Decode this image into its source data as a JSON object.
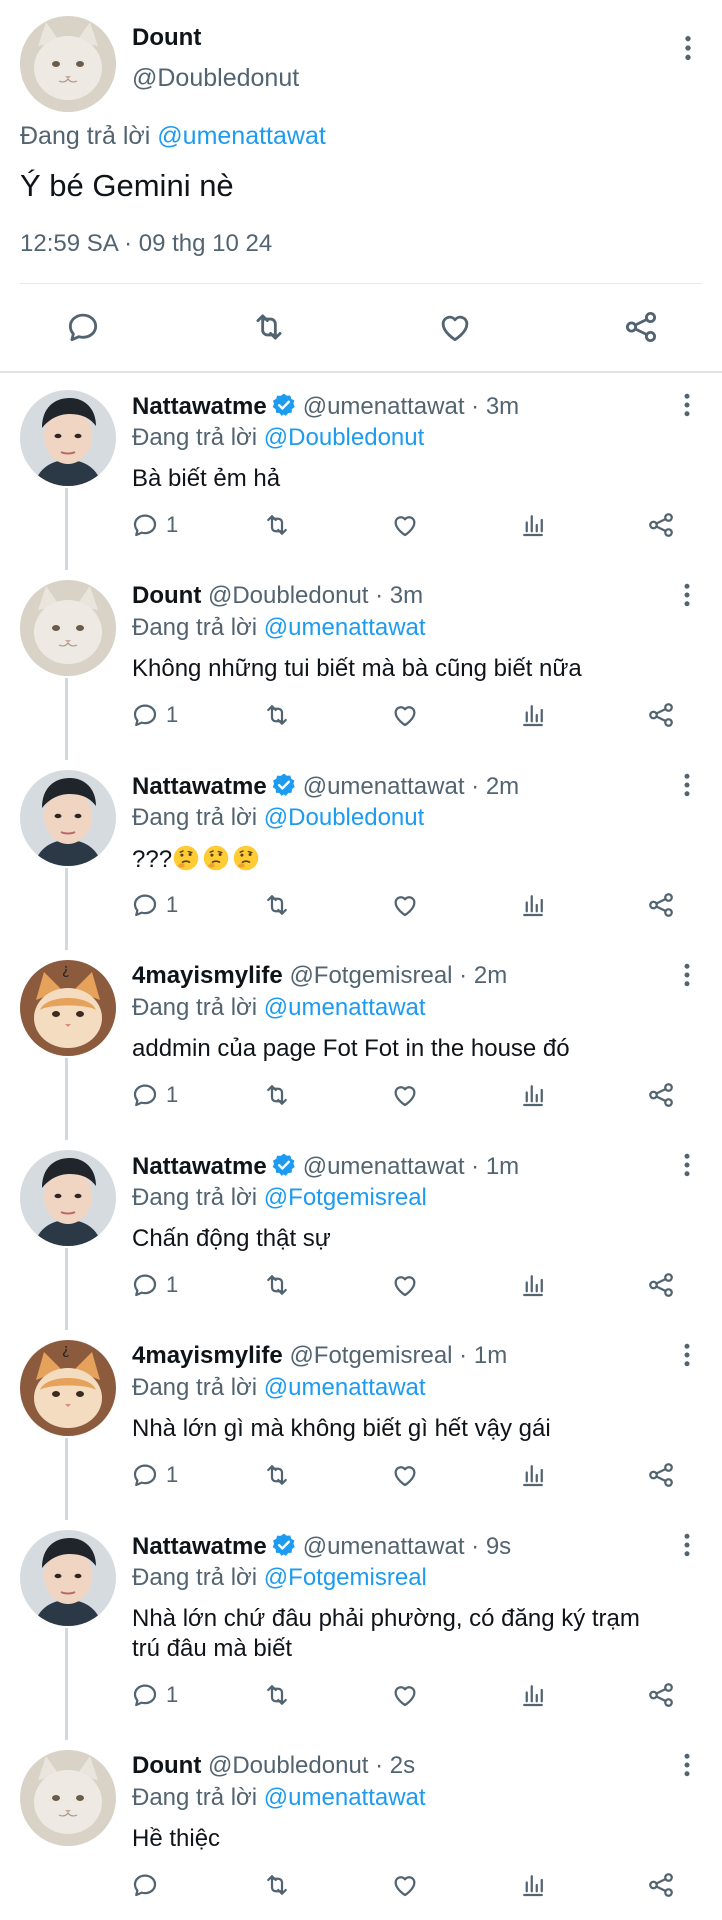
{
  "main_tweet": {
    "name": "Dount",
    "handle": "@Doubledonut",
    "reply_prefix": "Đang trả lời",
    "reply_to": "@umenattawat",
    "text": "Ý bé Gemini nè",
    "timestamp": "12:59 SA · 09 thg 10 24"
  },
  "replies": [
    {
      "name": "Nattawatme",
      "verified": true,
      "meta": "@umenattawat · 3m",
      "reply_prefix": "Đang trả lời",
      "reply_to": "@Doubledonut",
      "text": "Bà biết ẻm hả",
      "reply_count": "1"
    },
    {
      "name": "Dount",
      "verified": false,
      "meta": "@Doubledonut · 3m",
      "reply_prefix": "Đang trả lời",
      "reply_to": "@umenattawat",
      "text": "Không những tui biết mà bà cũng biết nữa",
      "reply_count": "1"
    },
    {
      "name": "Nattawatme",
      "verified": true,
      "meta": "@umenattawat · 2m",
      "reply_prefix": "Đang trả lời",
      "reply_to": "@Doubledonut",
      "text": "???",
      "reply_count": "1"
    },
    {
      "name": "4mayismylife",
      "verified": false,
      "meta": "@Fotgemisreal · 2m",
      "reply_prefix": "Đang trả lời",
      "reply_to": "@umenattawat",
      "text": "addmin của page Fot Fot in the house đó",
      "reply_count": "1"
    },
    {
      "name": "Nattawatme",
      "verified": true,
      "meta": "@umenattawat · 1m",
      "reply_prefix": "Đang trả lời",
      "reply_to": "@Fotgemisreal",
      "text": "Chấn động thật sự",
      "reply_count": "1"
    },
    {
      "name": "4mayismylife",
      "verified": false,
      "meta": "@Fotgemisreal · 1m",
      "reply_prefix": "Đang trả lời",
      "reply_to": "@umenattawat",
      "text": "Nhà lớn gì mà không biết gì hết vậy gái",
      "reply_count": "1"
    },
    {
      "name": "Nattawatme",
      "verified": true,
      "meta": "@umenattawat · 9s",
      "reply_prefix": "Đang trả lời",
      "reply_to": "@Fotgemisreal",
      "text_line1": "Nhà lớn chứ đâu phải phường, có đăng ký trạm",
      "text_line2": "trú đâu mà biết",
      "reply_count": "1"
    },
    {
      "name": "Dount",
      "verified": false,
      "meta": "@Doubledonut · 2s",
      "reply_prefix": "Đang trả lời",
      "reply_to": "@umenattawat",
      "text": "Hề thiệc",
      "reply_count": ""
    }
  ],
  "icons": [
    "reply-icon",
    "retweet-icon",
    "like-icon",
    "analytics-icon",
    "share-icon",
    "more-icon",
    "verified-icon",
    "thinking-emoji"
  ],
  "colors": {
    "link": "#1d9bf0",
    "secondary_text": "#536471",
    "verified": "#1d9bf0"
  }
}
